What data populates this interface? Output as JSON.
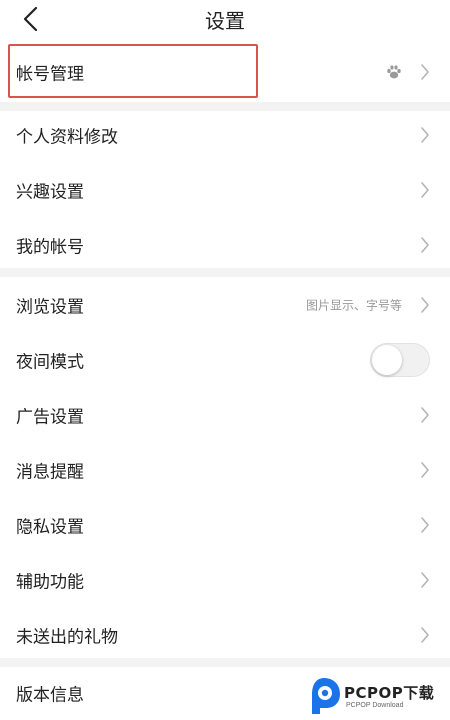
{
  "header": {
    "back_icon": "chevron-left-icon",
    "title": "设置"
  },
  "section1": {
    "items": [
      {
        "label": "帐号管理",
        "icon": "paw-icon"
      }
    ]
  },
  "section2": {
    "items": [
      {
        "label": "个人资料修改"
      },
      {
        "label": "兴趣设置"
      },
      {
        "label": "我的帐号"
      }
    ]
  },
  "section3": {
    "items": [
      {
        "label": "浏览设置",
        "hint": "图片显示、字号等"
      },
      {
        "label": "夜间模式",
        "toggle": false
      },
      {
        "label": "广告设置"
      },
      {
        "label": "消息提醒"
      },
      {
        "label": "隐私设置"
      },
      {
        "label": "辅助功能"
      },
      {
        "label": "未送出的礼物"
      }
    ]
  },
  "section4": {
    "items": [
      {
        "label": "版本信息"
      }
    ]
  },
  "watermark": {
    "brand": "PCPOP下载",
    "sub": "PCPOP Download"
  },
  "colors": {
    "highlight_border": "#d9534f",
    "divider": "#f3f3f3",
    "chevron": "#b5b5b5",
    "watermark_blue": "#1a73e8"
  }
}
